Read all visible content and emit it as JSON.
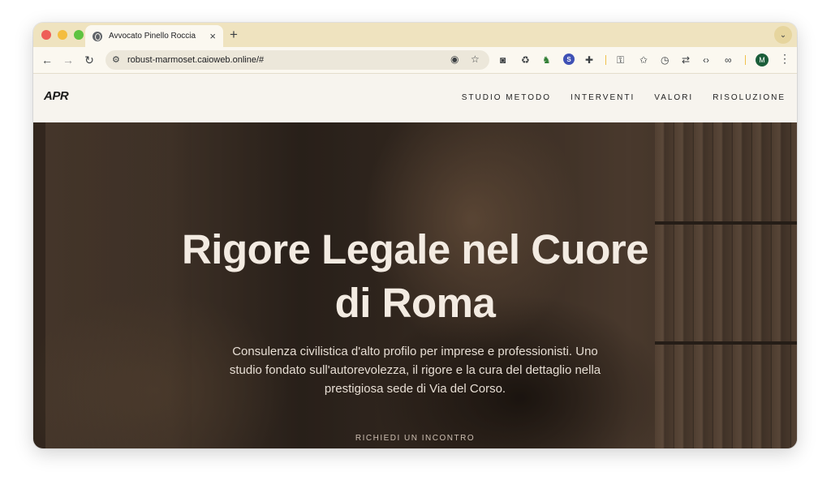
{
  "browser": {
    "tab_title": "Avvocato Pinello Roccia",
    "tab_close": "×",
    "new_tab": "+",
    "tab_menu": "⌄",
    "url": "robust-marmoset.caioweb.online/#",
    "avatar_initial": "M",
    "extension_badge": "S",
    "icons": {
      "back": "←",
      "forward": "→",
      "reload": "↻",
      "site_info": "⚙",
      "eye_off": "◉",
      "star": "☆",
      "camera": "◙",
      "recycle": "♻",
      "android": "♞",
      "puzzle": "✚",
      "key": "⚿",
      "bookmark_star": "✩",
      "history": "◷",
      "translate": "⇄",
      "code": "‹›",
      "link": "∞",
      "menu": "⋮"
    }
  },
  "site": {
    "logo": "APR",
    "nav": [
      {
        "label": "STUDIO METODO"
      },
      {
        "label": "INTERVENTI"
      },
      {
        "label": "VALORI"
      },
      {
        "label": "RISOLUZIONE"
      }
    ]
  },
  "hero": {
    "title_line1": "Rigore Legale nel Cuore",
    "title_line2": "di Roma",
    "subtitle": "Consulenza civilistica d'alto profilo per imprese e professionisti. Uno studio fondato sull'autorevolezza, il rigore e la cura del dettaglio nella prestigiosa sede di Via del Corso.",
    "cta_label": "RICHIEDI UN INCONTRO"
  }
}
